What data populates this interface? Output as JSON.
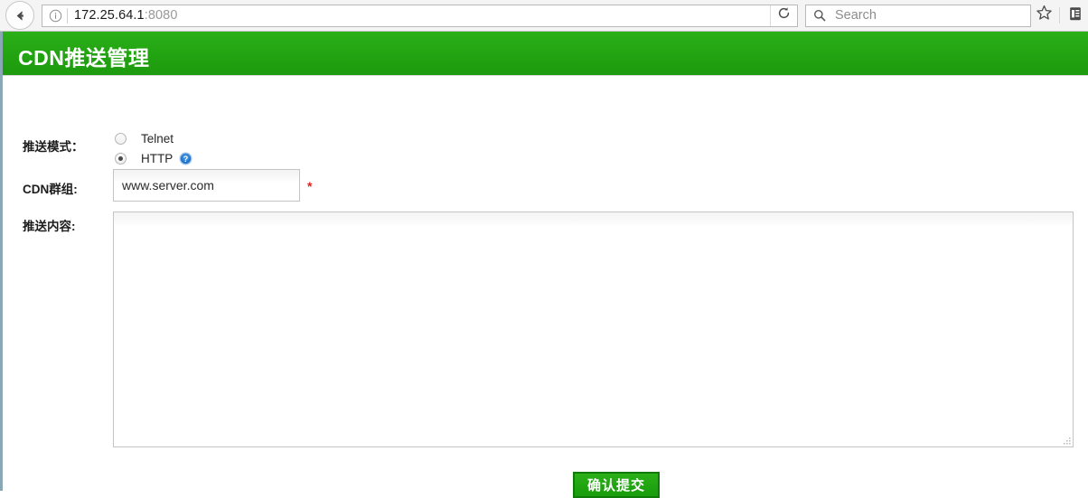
{
  "browser": {
    "back_icon": "back-arrow-icon",
    "identity_icon": "info-circle-icon",
    "url_host": "172.25.64.1",
    "url_port": ":8080",
    "reload_icon": "reload-icon",
    "search_icon": "search-icon",
    "search_value": "",
    "search_placeholder": "Search",
    "bookmark_icon": "star-icon",
    "library_icon": "library-icon"
  },
  "app": {
    "title": "CDN推送管理",
    "header_color": "#23a512"
  },
  "form": {
    "mode": {
      "label": "推送模式：",
      "options": [
        {
          "label": "Telnet",
          "checked": false
        },
        {
          "label": "HTTP",
          "checked": true,
          "help_icon": "help-circle-icon"
        }
      ]
    },
    "cdn_group": {
      "label": "CDN群组:",
      "value": "www.server.com",
      "placeholder": "",
      "required_mark": "*",
      "required_color": "#e02020"
    },
    "push_content": {
      "label": "推送内容:",
      "value": "",
      "placeholder": ""
    },
    "submit": {
      "label": "确认提交"
    }
  }
}
